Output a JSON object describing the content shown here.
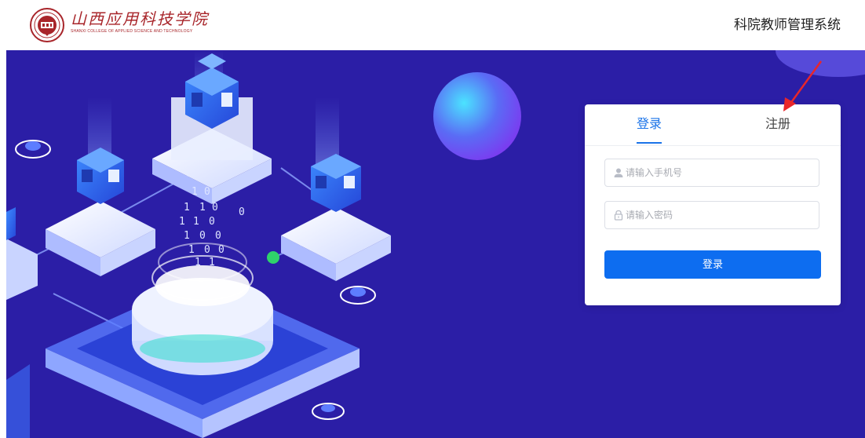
{
  "header": {
    "logo_cn": "山西应用科技学院",
    "logo_en": "SHANXI COLLEGE OF APPLIED SCIENCE AND TECHNOLOGY",
    "system_title": "科院教师管理系统"
  },
  "login": {
    "tabs": [
      {
        "label": "登录",
        "active": true
      },
      {
        "label": "注册",
        "active": false
      }
    ],
    "phone_placeholder": "请输入手机号",
    "password_placeholder": "请输入密码",
    "submit_label": "登录"
  },
  "illustration": {
    "binary_digits": [
      "1",
      "0",
      "1",
      "1",
      "0",
      "1",
      "1",
      "0",
      "1",
      "0",
      "0",
      "1",
      "0",
      "0",
      "1",
      "1",
      "0"
    ]
  },
  "colors": {
    "hero_bg": "#2b1ea6",
    "accent": "#1a73e8",
    "button": "#0d6df0",
    "logo_red": "#a8252a",
    "annotation_arrow": "#e8262b"
  },
  "icons": {
    "phone_field": "user-icon",
    "password_field": "lock-icon",
    "logo": "college-seal-icon"
  }
}
